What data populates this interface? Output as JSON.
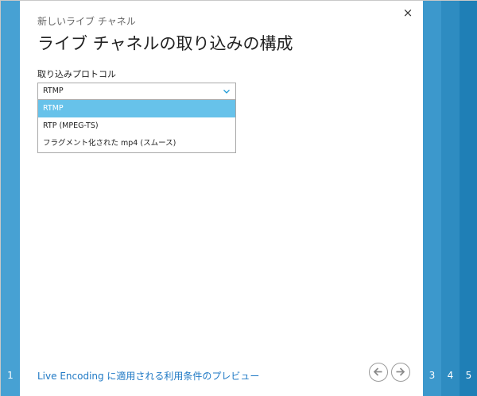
{
  "wizard": {
    "subtitle": "新しいライブ チャネル",
    "title": "ライブ チャネルの取り込みの構成",
    "steps": {
      "left": "1",
      "s3": "3",
      "s4": "4",
      "s5": "5"
    },
    "close_icon": "×"
  },
  "protocol": {
    "label": "取り込みプロトコル",
    "selected": "RTMP",
    "options": [
      "RTMP",
      "RTP (MPEG-TS)",
      "フラグメント化された mp4 (スムース)"
    ]
  },
  "footer": {
    "link_text": "Live Encoding に適用される利用条件のプレビュー"
  },
  "colors": {
    "accent": "#47a1d3",
    "selected_option": "#67c2ea",
    "link": "#1f79c5"
  }
}
